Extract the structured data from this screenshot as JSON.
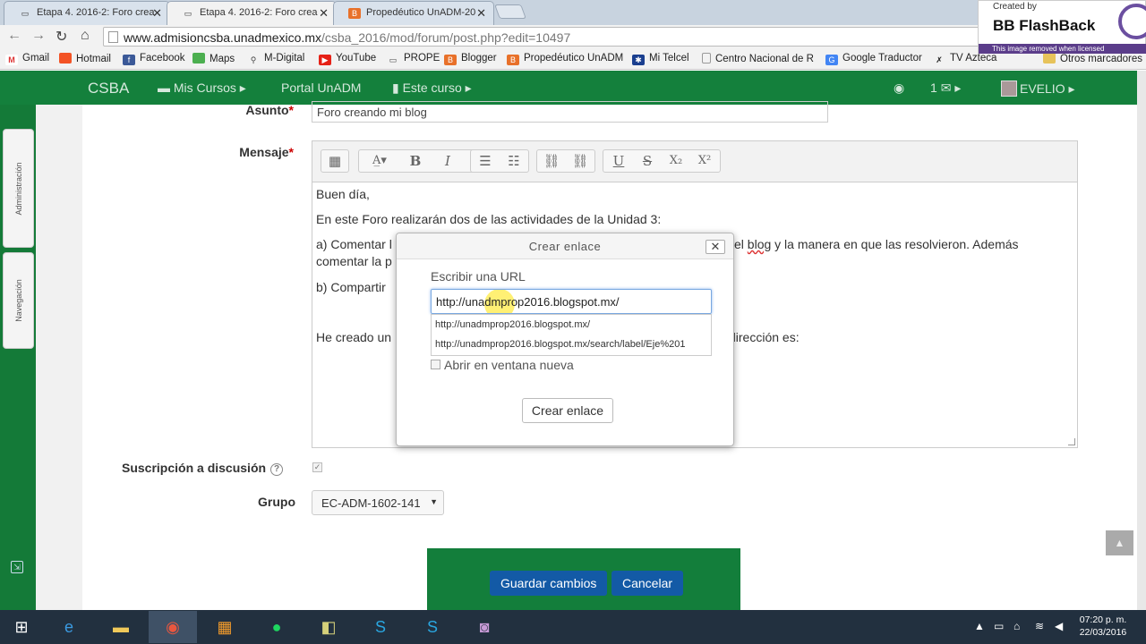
{
  "browser": {
    "tabs": [
      {
        "title": "Etapa 4. 2016-2: Foro crea",
        "close": "✕"
      },
      {
        "title": "Etapa 4. 2016-2: Foro crea",
        "close": "✕"
      },
      {
        "title": "Propedéutico UnADM-20",
        "close": "✕"
      }
    ],
    "url_host": "www.admisioncsba.unadmexico.mx",
    "url_path": "/csba_2016/mod/forum/post.php?edit=10497",
    "bookmarks": [
      "Gmail",
      "Hotmail",
      "Facebook",
      "Maps",
      "M-Digital",
      "YouTube",
      "PROPE",
      "Blogger",
      "Propedéutico UnADM",
      "Mi Telcel",
      "Centro Nacional de R",
      "Google Traductor",
      "TV Azteca",
      "Otros marcadores"
    ]
  },
  "watermark": {
    "created_by": "Created by",
    "product": "BB FlashBack",
    "note": "This image removed when licensed"
  },
  "moodle_nav": {
    "brand": "CSBA",
    "mis_cursos": "Mis Cursos ▸",
    "portal": "Portal UnADM",
    "este_curso": "Este curso ▸",
    "messages": "1",
    "user": "EVELIO ▸"
  },
  "side_tabs": {
    "admin": "Administración",
    "nav": "Navegación"
  },
  "form": {
    "asunto_label": "Asunto",
    "asunto_value": "Foro creando mi blog",
    "mensaje_label": "Mensaje",
    "required": "*",
    "editor_lines": {
      "l1": "Buen día,",
      "l2": "En este Foro realizarán dos de las actividades de la Unidad 3:",
      "l3a": "a) Comentar l",
      "l3b": "el ",
      "l3c": "blog",
      "l3d": " y la manera en que las resolvieron. Además",
      "l4": "comentar la p",
      "l5": "b) Compartir",
      "l6a": "He creado un",
      "l6b": "dirección es:"
    },
    "subscription_label": "Suscripción a discusión",
    "grupo_label": "Grupo",
    "grupo_value": "EC-ADM-1602-141",
    "save": "Guardar cambios",
    "cancel": "Cancelar"
  },
  "modal": {
    "title": "Crear enlace",
    "close": "✕",
    "url_label": "Escribir una URL",
    "url_value": "http://unadmprop2016.blogspot.mx/",
    "suggestions": [
      "http://unadmprop2016.blogspot.mx/",
      "http://unadmprop2016.blogspot.mx/search/label/Eje%201"
    ],
    "new_window": "Abrir en ventana nueva",
    "create": "Crear enlace"
  },
  "taskbar": {
    "time": "07:20 p. m.",
    "date": "22/03/2016"
  },
  "colors": {
    "moodle_green": "#14803c",
    "button_blue": "#135aa6"
  }
}
